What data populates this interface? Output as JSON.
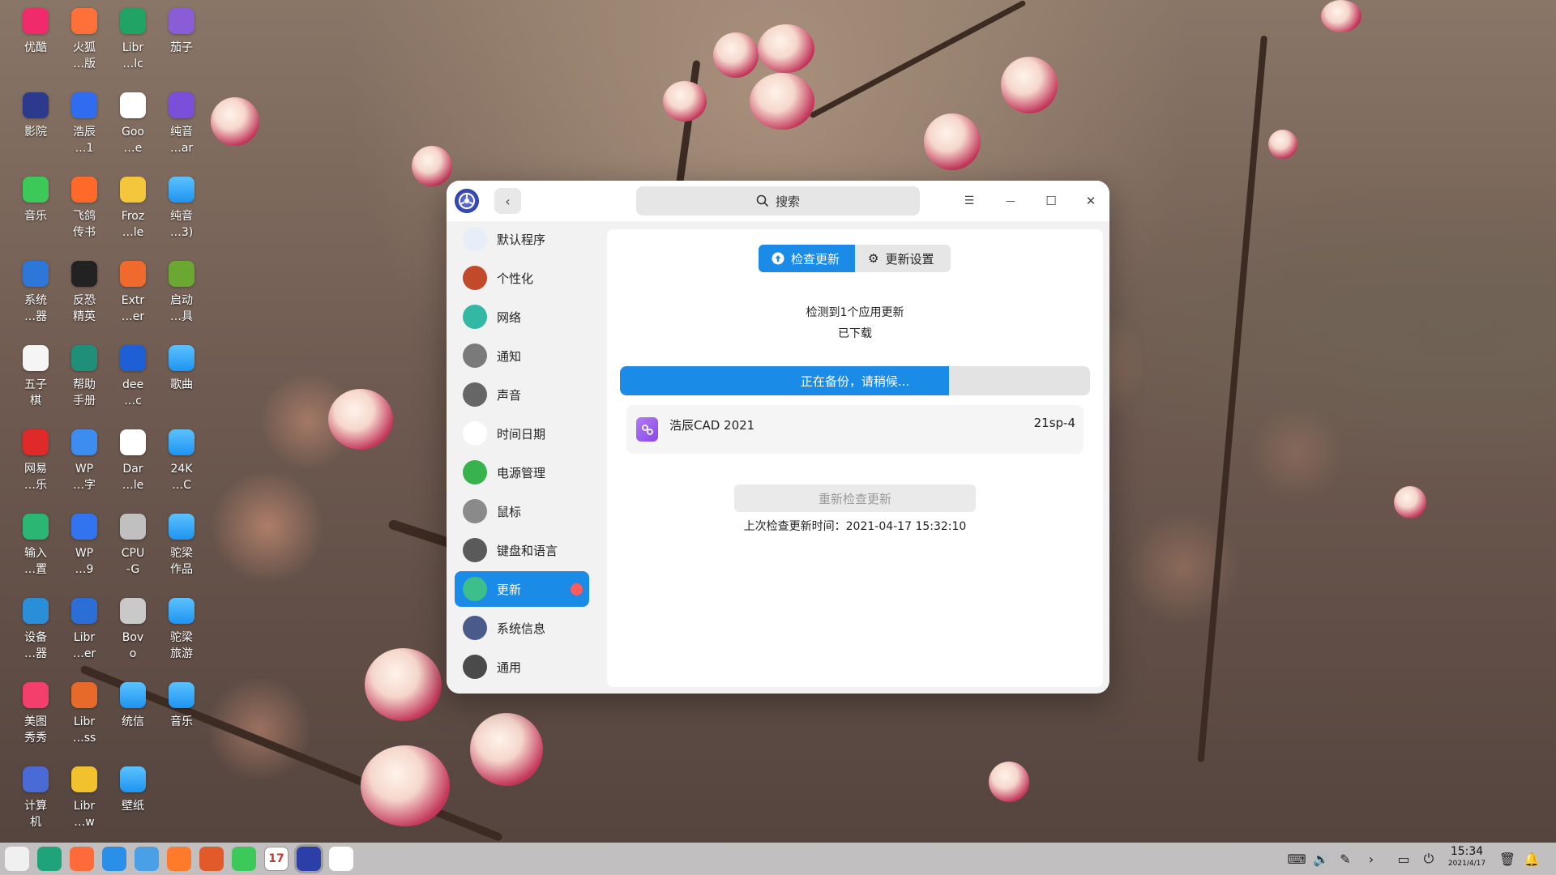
{
  "desktop": {
    "icons": [
      {
        "label": "优酷",
        "icon": "youku-icon",
        "color": "#f12b6b"
      },
      {
        "label": "火狐\n…版",
        "icon": "firefox-icon",
        "color": "#ff7139"
      },
      {
        "label": "Libr\n…lc",
        "icon": "libreoffice-calc-icon",
        "color": "#21a366"
      },
      {
        "label": "茄子",
        "icon": "cheese-icon",
        "color": "#8a5cd6"
      },
      {
        "label": "影院",
        "icon": "movie-icon",
        "color": "#2b3a8c"
      },
      {
        "label": "浩辰\n…1",
        "icon": "gstarcad-icon",
        "color": "#2f6cf0"
      },
      {
        "label": "Goo\n…e",
        "icon": "chrome-icon",
        "color": "#ffffff"
      },
      {
        "label": "纯音\n…ar",
        "icon": "rar-icon",
        "color": "#7b4fd8"
      },
      {
        "label": "音乐",
        "icon": "music-icon",
        "color": "#3cc95a"
      },
      {
        "label": "飞鸽\n传书",
        "icon": "feige-icon",
        "color": "#ff6a2a"
      },
      {
        "label": "Froz\n…le",
        "icon": "frozen-bubble-icon",
        "color": "#f3c63c"
      },
      {
        "label": "纯音\n…3)",
        "icon": "folder-icon",
        "color": "#2aa2f6"
      },
      {
        "label": "系统\n…器",
        "icon": "system-monitor-icon",
        "color": "#2d77d8"
      },
      {
        "label": "反恐\n精英",
        "icon": "counter-strike-icon",
        "color": "#222222"
      },
      {
        "label": "Extr\n…er",
        "icon": "extreme-tux-icon",
        "color": "#f06a2e"
      },
      {
        "label": "启动\n…具",
        "icon": "boot-maker-icon",
        "color": "#6aa832"
      },
      {
        "label": "五子\n棋",
        "icon": "gomoku-icon",
        "color": "#f5f5f5"
      },
      {
        "label": "帮助\n手册",
        "icon": "help-manual-icon",
        "color": "#1f8f7a"
      },
      {
        "label": "dee\n…c",
        "icon": "deepin-docs-icon",
        "color": "#1e5fd6"
      },
      {
        "label": "歌曲",
        "icon": "folder-icon",
        "color": "#2aa2f6"
      },
      {
        "label": "网易\n…乐",
        "icon": "netease-music-icon",
        "color": "#e02a2a"
      },
      {
        "label": "WP\n…字",
        "icon": "wps-writer-icon",
        "color": "#3d8cf0"
      },
      {
        "label": "Dar\n…le",
        "icon": "darktable-icon",
        "color": "#ffffff"
      },
      {
        "label": "24K\n…C",
        "icon": "folder-icon",
        "color": "#2aa2f6"
      },
      {
        "label": "输入\n…置",
        "icon": "input-method-icon",
        "color": "#2bb673"
      },
      {
        "label": "WP\n…9",
        "icon": "wps-icon",
        "color": "#3274f0"
      },
      {
        "label": "CPU\n-G",
        "icon": "cpu-g-icon",
        "color": "#c0c0c0"
      },
      {
        "label": "驼梁\n作品",
        "icon": "folder-icon",
        "color": "#2aa2f6"
      },
      {
        "label": "设备\n…器",
        "icon": "device-manager-icon",
        "color": "#2a8fd8"
      },
      {
        "label": "Libr\n…er",
        "icon": "libreoffice-writer-icon",
        "color": "#2a6ed6"
      },
      {
        "label": "Bov\no",
        "icon": "bovo-icon",
        "color": "#c9c9c9"
      },
      {
        "label": "驼梁\n旅游",
        "icon": "folder-icon",
        "color": "#2aa2f6"
      },
      {
        "label": "美图\n秀秀",
        "icon": "meitu-icon",
        "color": "#f43f6c"
      },
      {
        "label": "Libr\n…ss",
        "icon": "libreoffice-impress-icon",
        "color": "#e86a2a"
      },
      {
        "label": "统信",
        "icon": "folder-icon",
        "color": "#2aa2f6"
      },
      {
        "label": "音乐",
        "icon": "folder-icon",
        "color": "#2aa2f6"
      },
      {
        "label": "计算\n机",
        "icon": "computer-icon",
        "color": "#4a6bd6"
      },
      {
        "label": "Libr\n…w",
        "icon": "libreoffice-draw-icon",
        "color": "#f2c12e"
      },
      {
        "label": "壁纸",
        "icon": "folder-icon",
        "color": "#2aa2f6"
      }
    ]
  },
  "window": {
    "title_icon": "control-center-icon",
    "search_placeholder": "搜索",
    "search_icon": "search-icon",
    "buttons": {
      "menu": "☰",
      "minimize": "—",
      "maximize": "☐",
      "close": "✕",
      "back": "‹"
    }
  },
  "sidebar": {
    "items": [
      {
        "label": "默认程序",
        "icon": "default-apps-icon",
        "color": "#e8eef8"
      },
      {
        "label": "个性化",
        "icon": "personalization-icon",
        "color": "#c24a2a"
      },
      {
        "label": "网络",
        "icon": "network-icon",
        "color": "#33b8a4"
      },
      {
        "label": "通知",
        "icon": "bell-icon",
        "color": "#7a7a7a"
      },
      {
        "label": "声音",
        "icon": "speaker-icon",
        "color": "#666666"
      },
      {
        "label": "时间日期",
        "icon": "clock-icon",
        "color": "#ffffff"
      },
      {
        "label": "电源管理",
        "icon": "battery-icon",
        "color": "#37b24d"
      },
      {
        "label": "鼠标",
        "icon": "mouse-icon",
        "color": "#8a8a8a"
      },
      {
        "label": "键盘和语言",
        "icon": "keyboard-icon",
        "color": "#5a5a5a"
      },
      {
        "label": "更新",
        "icon": "update-icon",
        "color": "#3cbf8a"
      },
      {
        "label": "系统信息",
        "icon": "system-info-icon",
        "color": "#4a5a8a"
      },
      {
        "label": "通用",
        "icon": "general-icon",
        "color": "#4a4a4a"
      }
    ],
    "active_index": 9
  },
  "update": {
    "tabs": {
      "check": "检查更新",
      "settings": "更新设置"
    },
    "status_line1": "检测到1个应用更新",
    "status_line2": "已下载",
    "progress_text": "正在备份，请稍候...",
    "progress_fraction": 0.7,
    "app_name": "浩辰CAD 2021",
    "app_version": "21sp-4",
    "recheck_label": "重新检查更新",
    "last_check": "上次检查更新时间：2021-04-17 15:32:10"
  },
  "taskbar": {
    "apps": [
      {
        "icon": "launcher-icon",
        "color": "#f0f0f0"
      },
      {
        "icon": "multitasking-icon",
        "color": "#1fa37a"
      },
      {
        "icon": "app-store-icon",
        "color": "#ff6a3a"
      },
      {
        "icon": "file-manager-icon",
        "color": "#2a8fe8"
      },
      {
        "icon": "browser-icon",
        "color": "#4aa0e6"
      },
      {
        "icon": "appstore-bag-icon",
        "color": "#ff7a2a"
      },
      {
        "icon": "image-viewer-icon",
        "color": "#e25a2a"
      },
      {
        "icon": "music-icon",
        "color": "#3cc95a"
      },
      {
        "icon": "calendar-icon",
        "color": "#ffffff"
      },
      {
        "icon": "control-center-icon",
        "color": "#2c3ea8"
      },
      {
        "icon": "chrome-icon",
        "color": "#ffffff"
      }
    ],
    "calendar_day": "17",
    "time": "15:34",
    "date": "2021/4/17"
  }
}
